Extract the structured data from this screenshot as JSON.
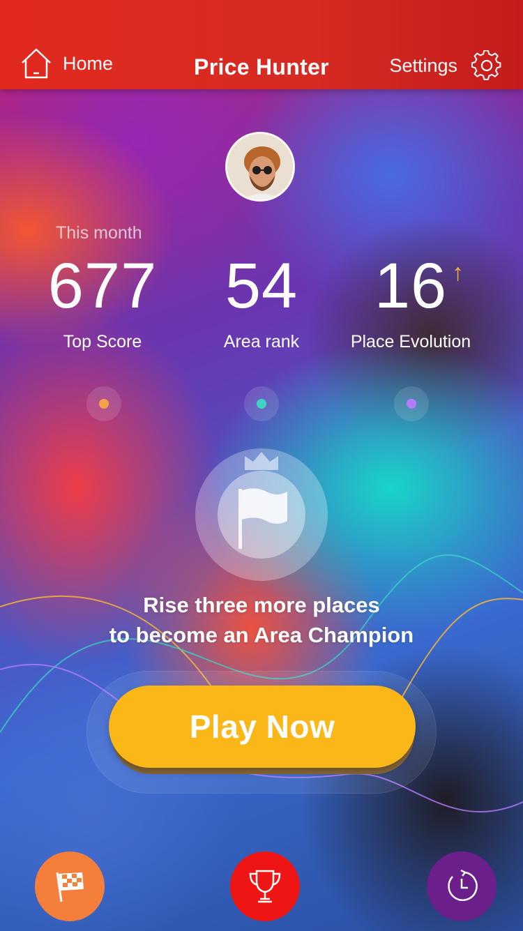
{
  "header": {
    "home_label": "Home",
    "title": "Price Hunter",
    "settings_label": "Settings"
  },
  "stats": {
    "period_label": "This month",
    "top_score": {
      "value": "677",
      "label": "Top Score",
      "dot_color": "#f6a04a"
    },
    "area_rank": {
      "value": "54",
      "label": "Area rank",
      "dot_color": "#3dd3c0"
    },
    "place_evolution": {
      "value": "16",
      "label": "Place Evolution",
      "dot_color": "#b57bff",
      "trend_icon": "arrow-up-icon",
      "trend_color": "#f3b32a"
    }
  },
  "badge": {
    "icon": "flag-icon",
    "crown_icon": "crown-icon"
  },
  "message": {
    "line1": "Rise three more places",
    "line2": "to become an Area Champion"
  },
  "cta": {
    "play_label": "Play Now",
    "color": "#fbb718"
  },
  "bottom_nav": [
    {
      "icon": "checkered-flag-icon",
      "color": "#f47f3a"
    },
    {
      "icon": "trophy-icon",
      "color": "#ef1515"
    },
    {
      "icon": "history-clock-icon",
      "color": "#6b1f8a"
    }
  ],
  "colors": {
    "header": "#d92a20",
    "text": "#ffffff"
  }
}
